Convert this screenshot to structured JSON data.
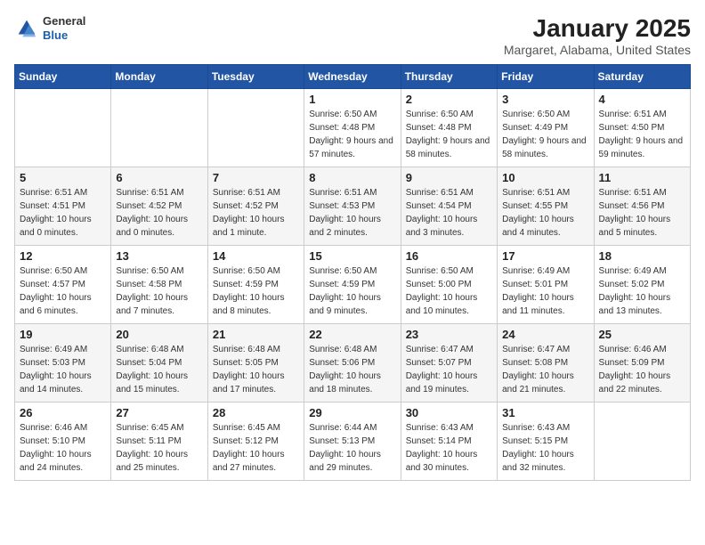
{
  "header": {
    "logo_general": "General",
    "logo_blue": "Blue",
    "title": "January 2025",
    "subtitle": "Margaret, Alabama, United States"
  },
  "weekdays": [
    "Sunday",
    "Monday",
    "Tuesday",
    "Wednesday",
    "Thursday",
    "Friday",
    "Saturday"
  ],
  "weeks": [
    [
      {
        "day": "",
        "info": ""
      },
      {
        "day": "",
        "info": ""
      },
      {
        "day": "",
        "info": ""
      },
      {
        "day": "1",
        "info": "Sunrise: 6:50 AM\nSunset: 4:48 PM\nDaylight: 9 hours and 57 minutes."
      },
      {
        "day": "2",
        "info": "Sunrise: 6:50 AM\nSunset: 4:48 PM\nDaylight: 9 hours and 58 minutes."
      },
      {
        "day": "3",
        "info": "Sunrise: 6:50 AM\nSunset: 4:49 PM\nDaylight: 9 hours and 58 minutes."
      },
      {
        "day": "4",
        "info": "Sunrise: 6:51 AM\nSunset: 4:50 PM\nDaylight: 9 hours and 59 minutes."
      }
    ],
    [
      {
        "day": "5",
        "info": "Sunrise: 6:51 AM\nSunset: 4:51 PM\nDaylight: 10 hours and 0 minutes."
      },
      {
        "day": "6",
        "info": "Sunrise: 6:51 AM\nSunset: 4:52 PM\nDaylight: 10 hours and 0 minutes."
      },
      {
        "day": "7",
        "info": "Sunrise: 6:51 AM\nSunset: 4:52 PM\nDaylight: 10 hours and 1 minute."
      },
      {
        "day": "8",
        "info": "Sunrise: 6:51 AM\nSunset: 4:53 PM\nDaylight: 10 hours and 2 minutes."
      },
      {
        "day": "9",
        "info": "Sunrise: 6:51 AM\nSunset: 4:54 PM\nDaylight: 10 hours and 3 minutes."
      },
      {
        "day": "10",
        "info": "Sunrise: 6:51 AM\nSunset: 4:55 PM\nDaylight: 10 hours and 4 minutes."
      },
      {
        "day": "11",
        "info": "Sunrise: 6:51 AM\nSunset: 4:56 PM\nDaylight: 10 hours and 5 minutes."
      }
    ],
    [
      {
        "day": "12",
        "info": "Sunrise: 6:50 AM\nSunset: 4:57 PM\nDaylight: 10 hours and 6 minutes."
      },
      {
        "day": "13",
        "info": "Sunrise: 6:50 AM\nSunset: 4:58 PM\nDaylight: 10 hours and 7 minutes."
      },
      {
        "day": "14",
        "info": "Sunrise: 6:50 AM\nSunset: 4:59 PM\nDaylight: 10 hours and 8 minutes."
      },
      {
        "day": "15",
        "info": "Sunrise: 6:50 AM\nSunset: 4:59 PM\nDaylight: 10 hours and 9 minutes."
      },
      {
        "day": "16",
        "info": "Sunrise: 6:50 AM\nSunset: 5:00 PM\nDaylight: 10 hours and 10 minutes."
      },
      {
        "day": "17",
        "info": "Sunrise: 6:49 AM\nSunset: 5:01 PM\nDaylight: 10 hours and 11 minutes."
      },
      {
        "day": "18",
        "info": "Sunrise: 6:49 AM\nSunset: 5:02 PM\nDaylight: 10 hours and 13 minutes."
      }
    ],
    [
      {
        "day": "19",
        "info": "Sunrise: 6:49 AM\nSunset: 5:03 PM\nDaylight: 10 hours and 14 minutes."
      },
      {
        "day": "20",
        "info": "Sunrise: 6:48 AM\nSunset: 5:04 PM\nDaylight: 10 hours and 15 minutes."
      },
      {
        "day": "21",
        "info": "Sunrise: 6:48 AM\nSunset: 5:05 PM\nDaylight: 10 hours and 17 minutes."
      },
      {
        "day": "22",
        "info": "Sunrise: 6:48 AM\nSunset: 5:06 PM\nDaylight: 10 hours and 18 minutes."
      },
      {
        "day": "23",
        "info": "Sunrise: 6:47 AM\nSunset: 5:07 PM\nDaylight: 10 hours and 19 minutes."
      },
      {
        "day": "24",
        "info": "Sunrise: 6:47 AM\nSunset: 5:08 PM\nDaylight: 10 hours and 21 minutes."
      },
      {
        "day": "25",
        "info": "Sunrise: 6:46 AM\nSunset: 5:09 PM\nDaylight: 10 hours and 22 minutes."
      }
    ],
    [
      {
        "day": "26",
        "info": "Sunrise: 6:46 AM\nSunset: 5:10 PM\nDaylight: 10 hours and 24 minutes."
      },
      {
        "day": "27",
        "info": "Sunrise: 6:45 AM\nSunset: 5:11 PM\nDaylight: 10 hours and 25 minutes."
      },
      {
        "day": "28",
        "info": "Sunrise: 6:45 AM\nSunset: 5:12 PM\nDaylight: 10 hours and 27 minutes."
      },
      {
        "day": "29",
        "info": "Sunrise: 6:44 AM\nSunset: 5:13 PM\nDaylight: 10 hours and 29 minutes."
      },
      {
        "day": "30",
        "info": "Sunrise: 6:43 AM\nSunset: 5:14 PM\nDaylight: 10 hours and 30 minutes."
      },
      {
        "day": "31",
        "info": "Sunrise: 6:43 AM\nSunset: 5:15 PM\nDaylight: 10 hours and 32 minutes."
      },
      {
        "day": "",
        "info": ""
      }
    ]
  ]
}
